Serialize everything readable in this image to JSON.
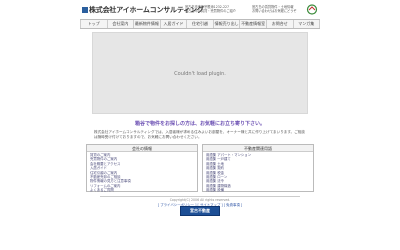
{
  "header": {
    "company_name": "株式会社アイホームコンサルティング",
    "note_left_1": "宮古島市東仲宗根添1232-227",
    "note_left_2": "宮古島市の賃貸・売買物件のご紹介",
    "note_right_1": "宮古島の賃貸物件・土地情報",
    "note_right_2": "お問い合わせはお気軽にどうぞ"
  },
  "nav": {
    "items": [
      "トップ",
      "会社案内",
      "最新物件情報",
      "入居ガイド",
      "住宅引越",
      "情報売り出し",
      "不動産情報室",
      "お問合せ",
      "マンガ集"
    ]
  },
  "plugin": {
    "message": "Couldn't load plugin."
  },
  "promo": {
    "text": "箱谷で物件をお探しの方は、お気軽にお立ち寄り下さい。"
  },
  "intro": {
    "text": "株式会社アイホームコンサルティングでは、入居者様が求める住みよいお部屋を、オーナー様と共に作り上げてまいります。ご相談は随時受け付けておりますので、お気軽にお問い合わせください。"
  },
  "panels": {
    "left": {
      "title": "会社の情報",
      "items": [
        "賃貸のご案内",
        "売買物件のご案内",
        "会社概要とアクセス",
        "入居ガイド",
        "住宅引越のご案内",
        "不動産売却のご相談",
        "物件情報の見方と注意事項",
        "リフォームのご案内",
        "よくあるご質問",
        "個人情報の取り扱いについて"
      ]
    },
    "right": {
      "title": "不動産関連用語",
      "items": [
        "用語集 アパート・マンション",
        "用語集 一戸建て",
        "用語集 土地",
        "用語集 契約",
        "用語集 税金",
        "用語集 ローン",
        "用語集 法令",
        "用語集 建物構造",
        "用語集 設備",
        "用語集 その他"
      ]
    }
  },
  "footer": {
    "copyright": "Copyright(C) 2006 All rights reserved.",
    "links": "[ プライバシーポリシー ] [ サイトマップ ] [ 免責事項 ]",
    "banner": "宮古不動産"
  },
  "colors": {
    "logo_square": "#2b5f9e",
    "promo_text": "#6b4fb3",
    "link": "#2e55a6",
    "banner_bg": "#1d4f96"
  }
}
